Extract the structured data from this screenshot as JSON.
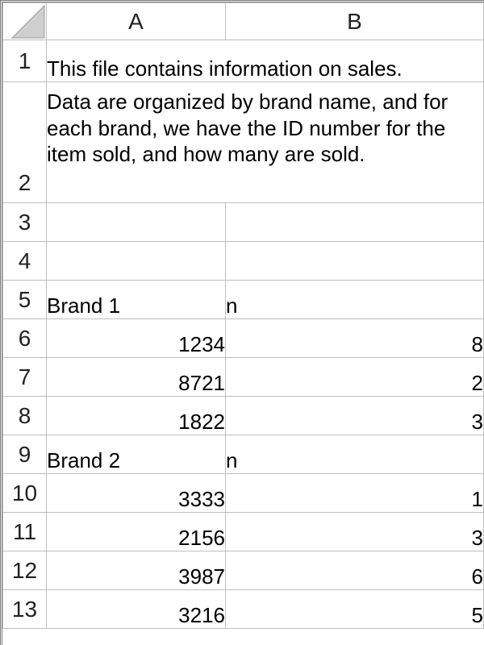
{
  "columns": [
    "A",
    "B"
  ],
  "row_numbers": [
    1,
    2,
    3,
    4,
    5,
    6,
    7,
    8,
    9,
    10,
    11,
    12,
    13
  ],
  "rows": {
    "1": {
      "merged": true,
      "text": "This file contains information on sales.",
      "height": 52
    },
    "2": {
      "merged": true,
      "text": "Data are organized by brand name, and for each brand, we have the ID number for the item sold, and how many are sold.",
      "height": 150,
      "wrap": true
    },
    "3": {
      "A": "",
      "B": ""
    },
    "4": {
      "A": "",
      "B": ""
    },
    "5": {
      "A": "Brand 1",
      "B": "n"
    },
    "6": {
      "A": "1234",
      "B": "8",
      "numA": true,
      "numB": true
    },
    "7": {
      "A": "8721",
      "B": "2",
      "numA": true,
      "numB": true
    },
    "8": {
      "A": "1822",
      "B": "3",
      "numA": true,
      "numB": true
    },
    "9": {
      "A": "Brand 2",
      "B": "n"
    },
    "10": {
      "A": "3333",
      "B": "1",
      "numA": true,
      "numB": true
    },
    "11": {
      "A": "2156",
      "B": "3",
      "numA": true,
      "numB": true
    },
    "12": {
      "A": "3987",
      "B": "6",
      "numA": true,
      "numB": true
    },
    "13": {
      "A": "3216",
      "B": "5",
      "numA": true,
      "numB": true
    }
  }
}
